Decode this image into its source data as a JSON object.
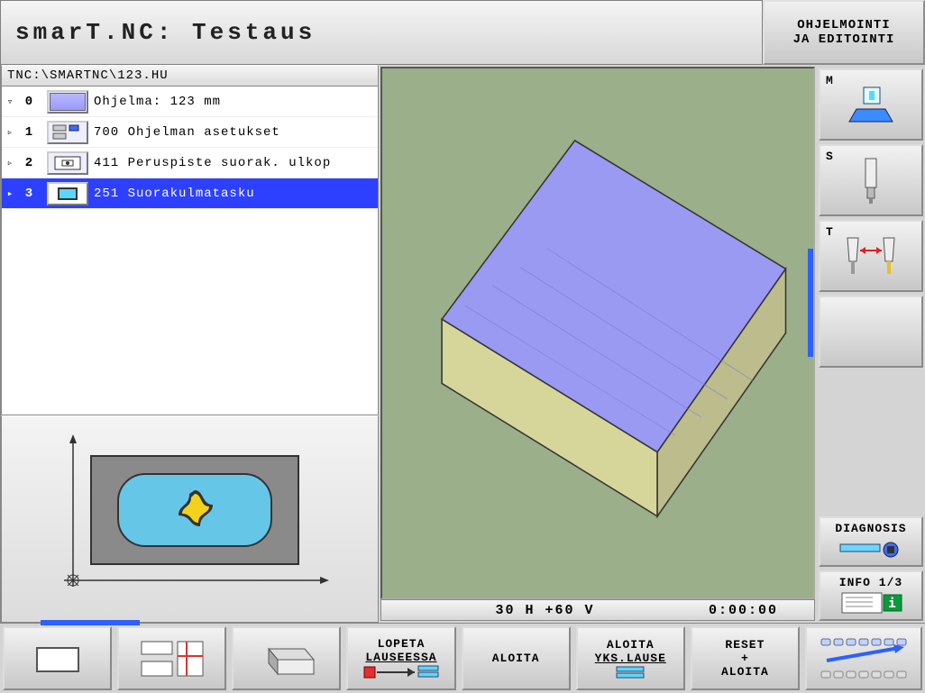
{
  "header": {
    "title": "smarT.NC: Testaus",
    "mode_line1": "OHJELMOINTI",
    "mode_line2": "JA EDITOINTI"
  },
  "path": "TNC:\\SMARTNC\\123.HU",
  "tree": {
    "items": [
      {
        "toggle": "▿",
        "num": "0",
        "text": "Ohjelma: 123 mm",
        "selected": false
      },
      {
        "toggle": "▹",
        "num": "1",
        "text": "700 Ohjelman asetukset",
        "selected": false
      },
      {
        "toggle": "▹",
        "num": "2",
        "text": "411 Peruspiste suorak. ulkop",
        "selected": false
      },
      {
        "toggle": "▸",
        "num": "3",
        "text": "251 Suorakulmatasku",
        "selected": true
      }
    ]
  },
  "status": {
    "coords": "30 H +60 V",
    "time": "0:00:00"
  },
  "sidebar": {
    "m": "M",
    "s": "S",
    "t": "T",
    "diagnosis": "DIAGNOSIS",
    "info": "INFO 1/3"
  },
  "softkeys": {
    "k4a": "LOPETA",
    "k4b": "LAUSEESSA",
    "k5": "ALOITA",
    "k6a": "ALOITA",
    "k6b": "YKS.LAUSE",
    "k7a": "RESET",
    "k7b": "+",
    "k7c": "ALOITA"
  }
}
